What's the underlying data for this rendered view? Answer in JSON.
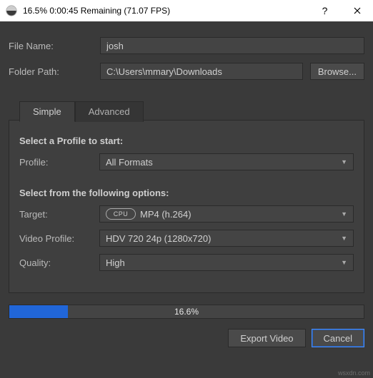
{
  "titlebar": {
    "title": "16.5%  0:00:45 Remaining (71.07 FPS)"
  },
  "fields": {
    "file_name_label": "File Name:",
    "file_name_value": "josh",
    "folder_path_label": "Folder Path:",
    "folder_path_value": "C:\\Users\\mmary\\Downloads",
    "browse_label": "Browse..."
  },
  "tabs": {
    "simple": "Simple",
    "advanced": "Advanced"
  },
  "sections": {
    "profile_hdr": "Select a Profile to start:",
    "options_hdr": "Select from the following options:"
  },
  "profile": {
    "label": "Profile:",
    "value": "All Formats"
  },
  "target": {
    "label": "Target:",
    "badge": "CPU",
    "value": "MP4 (h.264)"
  },
  "video_profile": {
    "label": "Video Profile:",
    "value": "HDV 720 24p (1280x720)"
  },
  "quality": {
    "label": "Quality:",
    "value": "High"
  },
  "progress": {
    "percent_text": "16.6%",
    "percent_value": 16.6
  },
  "buttons": {
    "export": "Export Video",
    "cancel": "Cancel"
  },
  "watermark": "wsxdn.com"
}
